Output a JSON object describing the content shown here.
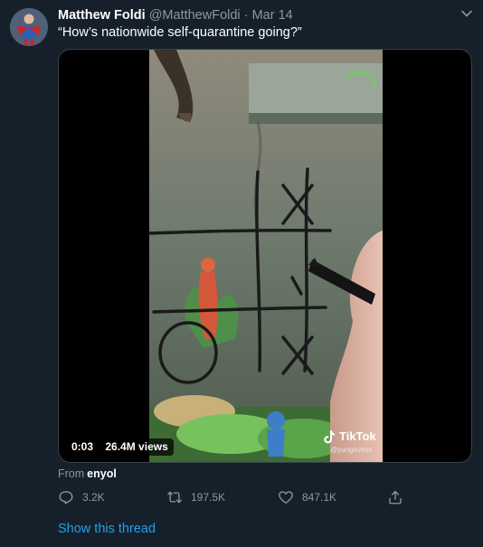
{
  "tweet": {
    "author_name": "Matthew Foldi",
    "author_handle": "@MatthewFoldi",
    "separator": "·",
    "date": "Mar 14",
    "text": "“How’s nationwide self-quarantine going?”",
    "menu_icon": "chevron-down-icon"
  },
  "media": {
    "time": "0:03",
    "views": "26.4M views",
    "watermark_brand": "TikTok",
    "watermark_user": "@yungavess"
  },
  "source": {
    "label": "From",
    "name": "enyol"
  },
  "actions": {
    "reply_icon": "reply-icon",
    "reply_count": "3.2K",
    "retweet_icon": "retweet-icon",
    "retweet_count": "197.5K",
    "like_icon": "heart-icon",
    "like_count": "847.1K",
    "share_icon": "share-icon"
  },
  "thread_link": "Show this thread",
  "colors": {
    "background": "#15202b",
    "secondary_text": "#8899a6",
    "link": "#1da1f2",
    "border": "#38444d"
  }
}
